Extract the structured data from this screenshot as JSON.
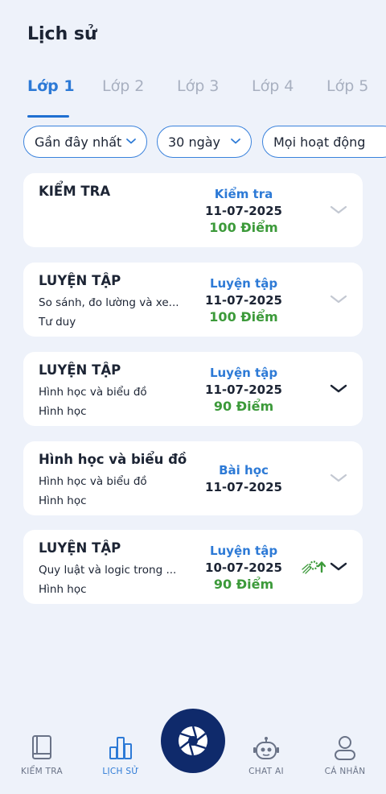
{
  "header": {
    "title": "Lịch sử"
  },
  "tabs": [
    {
      "label": "Lớp 1",
      "active": true
    },
    {
      "label": "Lớp 2",
      "active": false
    },
    {
      "label": "Lớp 3",
      "active": false
    },
    {
      "label": "Lớp 4",
      "active": false
    },
    {
      "label": "Lớp 5",
      "active": false
    }
  ],
  "filters": {
    "sort": "Gần đây nhất",
    "range": "30 ngày",
    "activity": "Mọi hoạt động"
  },
  "history": [
    {
      "title": "KIỂM TRA",
      "line1": "",
      "line2": "",
      "kind": "Kiểm tra",
      "date": "11-07-2025",
      "score": "100 Điểm",
      "chevron": "light"
    },
    {
      "title": "LUYỆN TẬP",
      "line1": "So sánh, đo lường và xe...",
      "line2": "Tư duy",
      "kind": "Luyện tập",
      "date": "11-07-2025",
      "score": "100 Điểm",
      "chevron": "light"
    },
    {
      "title": "LUYỆN TẬP",
      "line1": "Hình học và biểu đồ",
      "line2": "Hình học",
      "kind": "Luyện tập",
      "date": "11-07-2025",
      "score": "90 Điểm",
      "chevron": "dark"
    },
    {
      "title": "Hình học và biểu đồ",
      "line1": "Hình học và biểu đồ",
      "line2": "Hình học",
      "kind": "Bài học",
      "date": "11-07-2025",
      "score": "",
      "chevron": "light"
    },
    {
      "title": "LUYỆN TẬP",
      "line1": "Quy luật và logic trong ...",
      "line2": "Hình học",
      "kind": "Luyện tập",
      "date": "10-07-2025",
      "score": "90 Điểm",
      "chevron": "dark",
      "badge_icon": "level-up-icon"
    }
  ],
  "bottom_nav": {
    "test": "KIỂM TRA",
    "history": "LỊCH SỬ",
    "chat": "CHAT AI",
    "profile": "CÁ NHÂN"
  },
  "colors": {
    "accent": "#2d7ad6",
    "score_green": "#3c9a3a",
    "center_button": "#0f2a6b",
    "background": "#eef2fa"
  }
}
